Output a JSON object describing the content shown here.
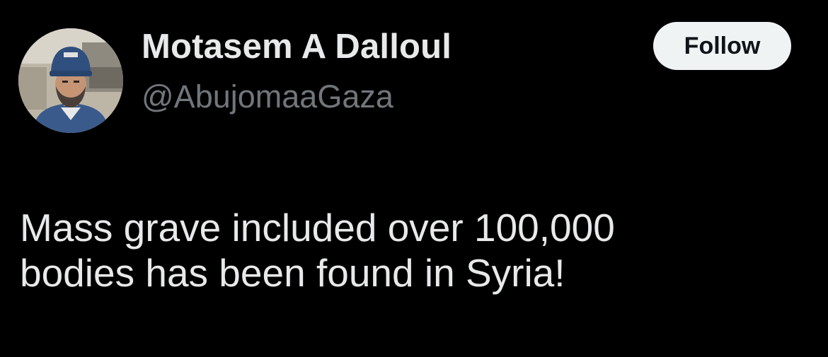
{
  "author": {
    "display_name": "Motasem A Dalloul",
    "handle": "@AbujomaaGaza",
    "avatar_icon": "profile-photo-avatar"
  },
  "follow_button": {
    "label": "Follow"
  },
  "tweet": {
    "text": "Mass grave included over 100,000\nbodies has been found in Syria!"
  },
  "colors": {
    "background": "#000000",
    "text_primary": "#e7e9ea",
    "text_secondary": "#71767b",
    "button_bg": "#eff3f4",
    "button_text": "#0f1419"
  }
}
